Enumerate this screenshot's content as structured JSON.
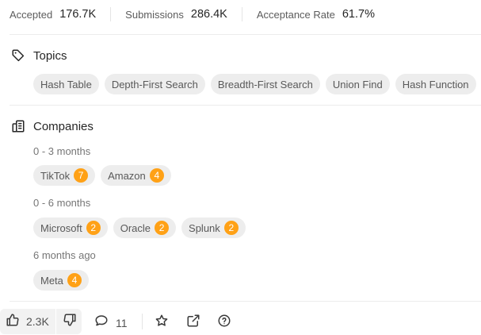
{
  "stats": {
    "accepted_label": "Accepted",
    "accepted_value": "176.7K",
    "submissions_label": "Submissions",
    "submissions_value": "286.4K",
    "acceptance_label": "Acceptance Rate",
    "acceptance_value": "61.7%"
  },
  "topics": {
    "title": "Topics",
    "icon": "tag-icon",
    "items": [
      "Hash Table",
      "Depth-First Search",
      "Breadth-First Search",
      "Union Find",
      "Hash Function"
    ]
  },
  "companies": {
    "title": "Companies",
    "icon": "building-icon",
    "groups": [
      {
        "period": "0 - 3 months",
        "items": [
          {
            "name": "TikTok",
            "count": "7"
          },
          {
            "name": "Amazon",
            "count": "4"
          }
        ]
      },
      {
        "period": "0 - 6 months",
        "items": [
          {
            "name": "Microsoft",
            "count": "2"
          },
          {
            "name": "Oracle",
            "count": "2"
          },
          {
            "name": "Splunk",
            "count": "2"
          }
        ]
      },
      {
        "period": "6 months ago",
        "items": [
          {
            "name": "Meta",
            "count": "4"
          }
        ]
      }
    ]
  },
  "toolbar": {
    "likes": "2.3K",
    "comments": "11",
    "icons": [
      "thumbs-up-icon",
      "thumbs-down-icon",
      "comment-icon",
      "star-icon",
      "share-icon",
      "help-icon"
    ]
  },
  "colors": {
    "accent": "#ffa116",
    "chip_bg": "#ededed",
    "text": "#262626",
    "muted": "#767676"
  }
}
